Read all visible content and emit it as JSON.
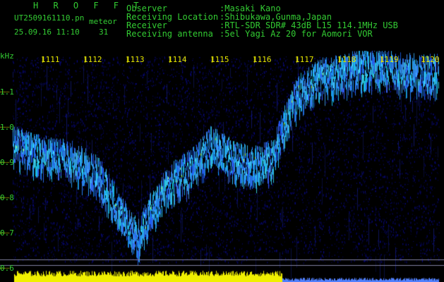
{
  "header": {
    "brand": "H R O F F T",
    "filename": "UT2509161110.pn",
    "mode": "meteor",
    "datetime": "25.09.16 11:10",
    "count": "31"
  },
  "info": [
    {
      "label": "Observer",
      "value": ":Masaki Kano"
    },
    {
      "label": "Receiving Location",
      "value": ":Shibukawa,Gunma,Japan"
    },
    {
      "label": "Receiver",
      "value": ":RTL-SDR SDR# 43dB L15 114.1MHz USB"
    },
    {
      "label": "Receiving antenna",
      "value": ":5el Yagi Az 20 for Aomori VOR"
    }
  ],
  "axis": {
    "unit": "kHz",
    "y_ticks": [
      "1.1",
      "1.0",
      "0.9",
      "0.8",
      "0.7",
      "0.6"
    ],
    "x_ticks": [
      "1111",
      "1112",
      "1113",
      "1114",
      "1115",
      "1116",
      "1117",
      "1118",
      "1119",
      "1120"
    ]
  },
  "colors": {
    "text_green": "#33cc33",
    "axis_yellow": "#e6e600",
    "background": "#000000",
    "noise_blue": "#0a0a7a",
    "signal_cyan": "#44ddff",
    "bottom_bar": "#f0f000"
  }
}
